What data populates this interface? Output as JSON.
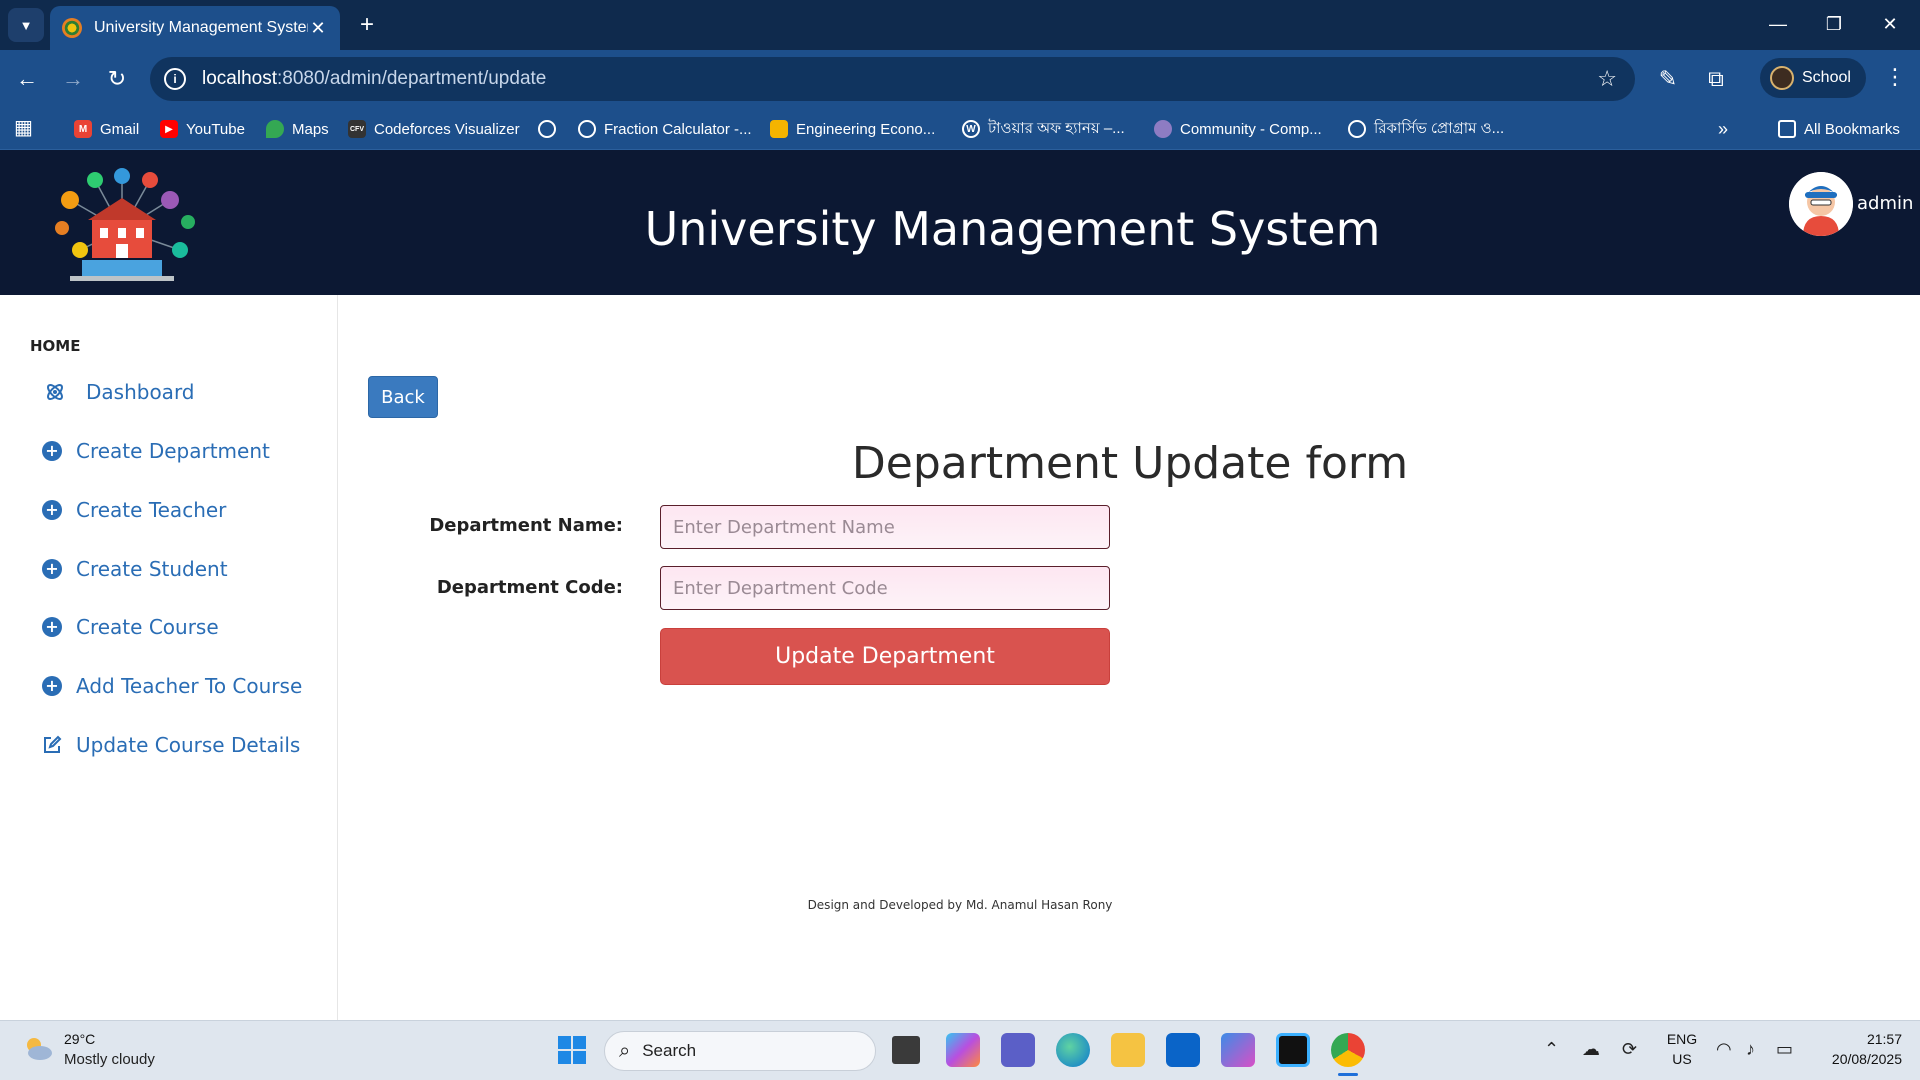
{
  "browser": {
    "tab_title": "University Management System",
    "url_host": "localhost",
    "url_path": ":8080/admin/department/update",
    "profile_name": "School",
    "bookmarks": [
      {
        "label": "Gmail",
        "icon": "gmail-icon",
        "color": "#ea4335"
      },
      {
        "label": "YouTube",
        "icon": "youtube-icon",
        "color": "#ff0000"
      },
      {
        "label": "Maps",
        "icon": "maps-icon",
        "color": "#34a853"
      },
      {
        "label": "Codeforces Visualizer",
        "icon": "cfv-icon",
        "color": "#333333"
      },
      {
        "label": "",
        "icon": "globe-icon",
        "color": "#ffffff"
      },
      {
        "label": "Fraction Calculator -...",
        "icon": "globe-icon",
        "color": "#ffffff"
      },
      {
        "label": "Engineering Econo...",
        "icon": "slides-icon",
        "color": "#f4b400"
      },
      {
        "label": "টাওয়ার অফ হ্যানয় –...",
        "icon": "wordpress-icon",
        "color": "#ffffff"
      },
      {
        "label": "Community - Comp...",
        "icon": "community-icon",
        "color": "#8e7cc3"
      },
      {
        "label": "রিকার্সিভ প্রোগ্রাম ও...",
        "icon": "globe-icon",
        "color": "#ffffff"
      }
    ],
    "all_bookmarks": "All Bookmarks"
  },
  "header": {
    "title": "University Management System",
    "user": "admin"
  },
  "sidebar": {
    "home": "HOME",
    "items": [
      {
        "label": "Dashboard",
        "icon": "dashboard-icon"
      },
      {
        "label": "Create Department",
        "icon": "plus-circle-icon"
      },
      {
        "label": "Create Teacher",
        "icon": "plus-circle-icon"
      },
      {
        "label": "Create Student",
        "icon": "plus-circle-icon"
      },
      {
        "label": "Create Course",
        "icon": "plus-circle-icon"
      },
      {
        "label": "Add Teacher To Course",
        "icon": "plus-circle-icon"
      },
      {
        "label": "Update Course Details",
        "icon": "edit-icon"
      }
    ]
  },
  "main": {
    "back_label": "Back",
    "form_title": "Department Update form",
    "name_label": "Department Name:",
    "name_placeholder": "Enter Department Name",
    "code_label": "Department Code:",
    "code_placeholder": "Enter Department Code",
    "submit_label": "Update Department",
    "footer": "Design and Developed by Md. Anamul Hasan Rony"
  },
  "taskbar": {
    "temperature": "29°C",
    "weather": "Mostly cloudy",
    "search": "Search",
    "lang_top": "ENG",
    "lang_bottom": "US",
    "time": "21:57",
    "date": "20/08/2025"
  },
  "colors": {
    "chrome_dark": "#0f2a4d",
    "chrome": "#1d4f8b",
    "header_bg": "#0c1833",
    "link_blue": "#2a6db5",
    "back_btn": "#3a7abf",
    "submit_btn": "#d9534f"
  }
}
